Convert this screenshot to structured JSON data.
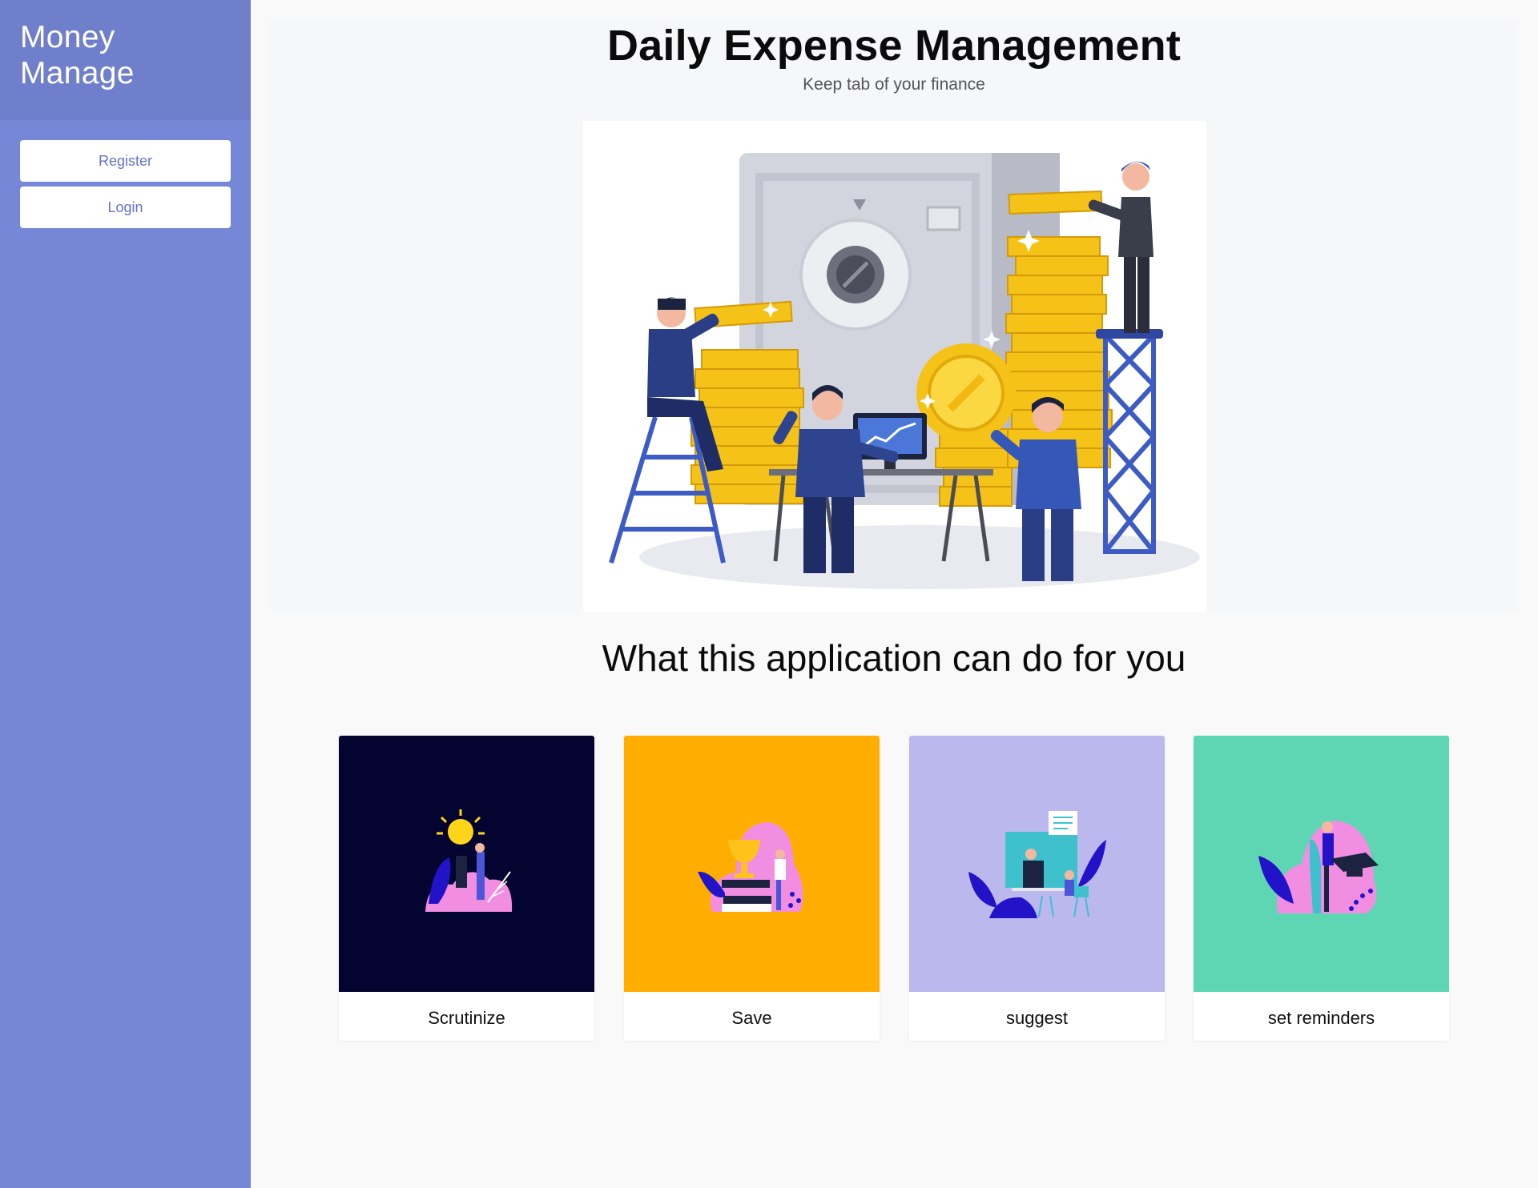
{
  "app": {
    "brand_line1": "Money",
    "brand_line2": "Manage"
  },
  "sidebar": {
    "buttons": [
      {
        "label": "Register"
      },
      {
        "label": "Login"
      }
    ]
  },
  "hero": {
    "title": "Daily Expense Management",
    "subtitle": "Keep tab of your finance"
  },
  "features": {
    "title": "What this application can do for you",
    "cards": [
      {
        "label": "Scrutinize",
        "color": "#03042f"
      },
      {
        "label": "Save",
        "color": "#ffae00"
      },
      {
        "label": "suggest",
        "color": "#bbb8ee"
      },
      {
        "label": "set reminders",
        "color": "#5fd6b3"
      }
    ]
  },
  "colors": {
    "sidebar": "#7587d6",
    "brand_header": "#6f7fcb",
    "button_text": "#6474c7",
    "coin_gold": "#f5c218",
    "figure_navy": "#2a3e86"
  }
}
